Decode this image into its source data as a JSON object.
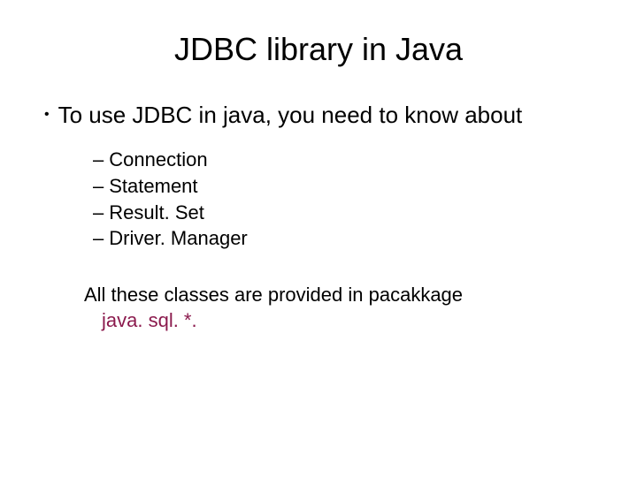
{
  "title": "JDBC library in Java",
  "mainBullet": "To use JDBC in java, you need to know about",
  "subItems": [
    "Connection",
    "Statement",
    "Result. Set",
    "Driver. Manager"
  ],
  "footerLine1": "All these classes are provided in pacakkage",
  "footerPackage": "java. sql. *.",
  "symbols": {
    "bullet": "•",
    "dash": "–"
  }
}
